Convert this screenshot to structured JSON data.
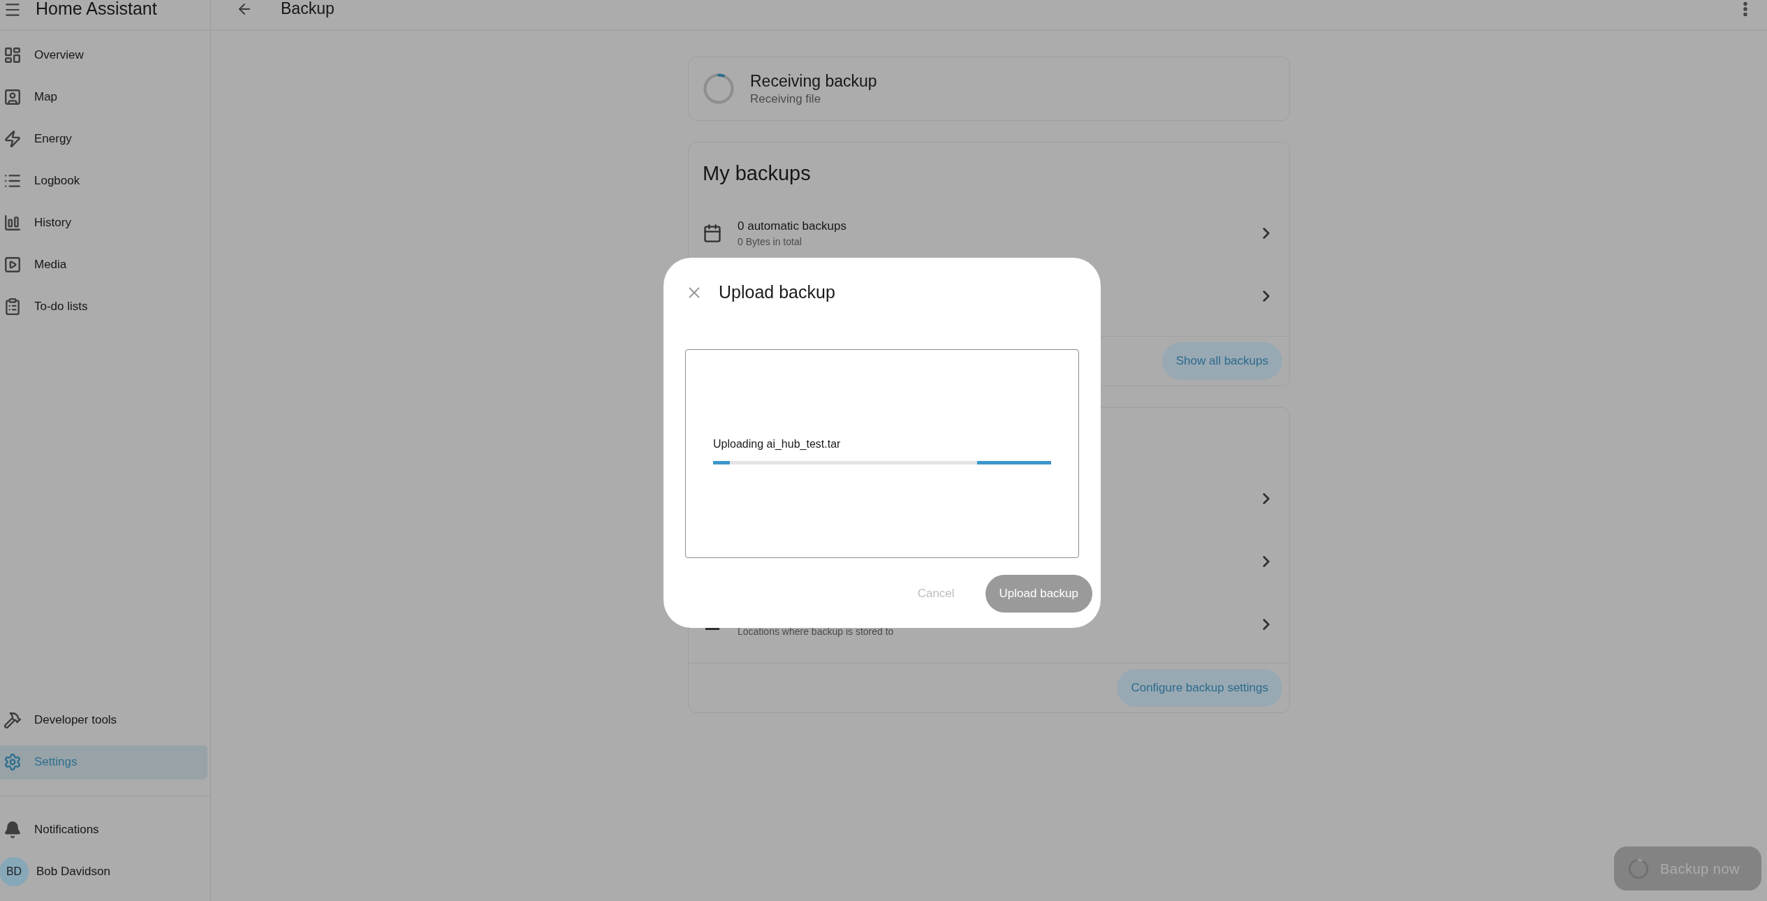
{
  "app_title": "Home Assistant",
  "sidebar": {
    "items": [
      {
        "label": "Overview",
        "selected": false
      },
      {
        "label": "Map",
        "selected": false
      },
      {
        "label": "Energy",
        "selected": false
      },
      {
        "label": "Logbook",
        "selected": false
      },
      {
        "label": "History",
        "selected": false
      },
      {
        "label": "Media",
        "selected": false
      },
      {
        "label": "To-do lists",
        "selected": false
      }
    ],
    "bottom_items": [
      {
        "label": "Developer tools",
        "selected": false
      },
      {
        "label": "Settings",
        "selected": true
      }
    ],
    "notifications": {
      "label": "Notifications"
    },
    "user": {
      "initials": "BD",
      "name": "Bob Davidson"
    }
  },
  "toolbar": {
    "title": "Backup"
  },
  "status_card": {
    "title": "Receiving backup",
    "subtitle": "Receiving file"
  },
  "my_backups": {
    "title": "My backups",
    "rows": [
      {
        "kind": "entry",
        "title": "0 automatic backups",
        "subtitle": "0 Bytes in total"
      },
      {
        "kind": "covered"
      }
    ],
    "button": "Show all backups"
  },
  "settings_card": {
    "rows": [
      {
        "kind": "covered"
      },
      {
        "kind": "covered"
      },
      {
        "kind": "partial",
        "subtitle": "Locations where backup is stored to"
      }
    ],
    "button": "Configure backup settings"
  },
  "dialog": {
    "title": "Upload backup",
    "upload": {
      "label": "Uploading ai_hub_test.tar",
      "indeterminate": true
    },
    "buttons": [
      {
        "label": "Cancel",
        "kind": "text",
        "disabled": true
      },
      {
        "label": "Upload backup",
        "kind": "filled",
        "disabled": true
      }
    ]
  },
  "fab": {
    "label": "Backup now",
    "disabled": true
  }
}
